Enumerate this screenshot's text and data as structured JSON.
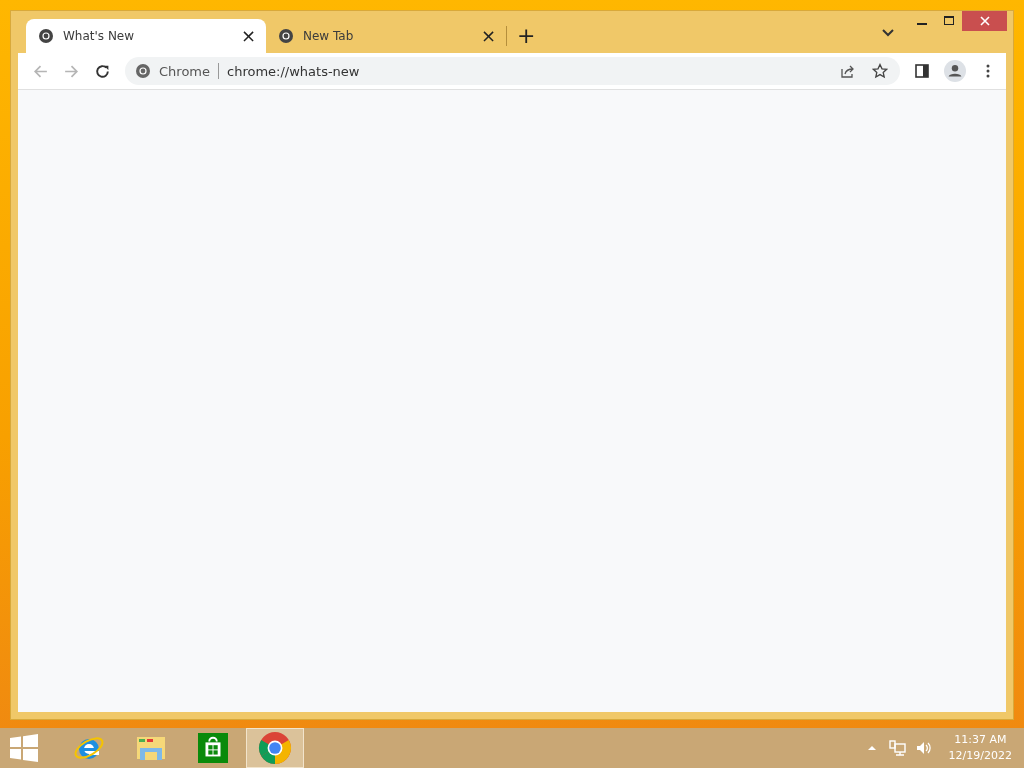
{
  "tabs": [
    {
      "title": "What's New",
      "selected": true,
      "close": "×"
    },
    {
      "title": "New Tab",
      "selected": false,
      "close": "×"
    }
  ],
  "new_tab": "+",
  "toolbar": {
    "back_disabled": true,
    "forward_disabled": true
  },
  "omnibox": {
    "chip": "Chrome",
    "url": "chrome://whats-new"
  },
  "taskbar": {
    "apps": [
      {
        "kind": "ie",
        "selected": false
      },
      {
        "kind": "explorer",
        "selected": false
      },
      {
        "kind": "store",
        "selected": false
      },
      {
        "kind": "chrome",
        "selected": true
      }
    ],
    "time": "11:37 AM",
    "date": "12/19/2022"
  }
}
